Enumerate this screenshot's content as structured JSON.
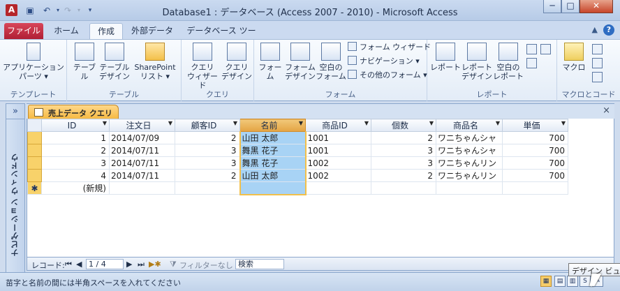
{
  "window": {
    "title": "Database1 : データベース (Access 2007 - 2010) - Microsoft Access",
    "app_icon": "A",
    "qat": [
      "save-icon",
      "undo-icon",
      "redo-icon",
      "customize-icon"
    ],
    "min": "─",
    "max": "□",
    "close": "✕"
  },
  "tabs": [
    {
      "label": "ファイル"
    },
    {
      "label": "ホーム"
    },
    {
      "label": "作成"
    },
    {
      "label": "外部データ"
    },
    {
      "label": "データベース ツール"
    }
  ],
  "ribbon": {
    "groups": {
      "template": {
        "label": "テンプレート",
        "app_parts_1": "アプリケーション",
        "app_parts_2": "パーツ ▾"
      },
      "table": {
        "label": "テーブル",
        "table": "テーブル",
        "table_design_1": "テーブル",
        "table_design_2": "デザイン",
        "sharepoint_1": "SharePoint",
        "sharepoint_2": "リスト ▾"
      },
      "query": {
        "label": "クエリ",
        "wizard_1": "クエリ",
        "wizard_2": "ウィザード",
        "design_1": "クエリ",
        "design_2": "デザイン"
      },
      "form": {
        "label": "フォーム",
        "form": "フォーム",
        "form_design_1": "フォーム",
        "form_design_2": "デザイン",
        "blank_1": "空白の",
        "blank_2": "フォーム",
        "form_wizard": "フォーム ウィザード",
        "navigation": "ナビゲーション ▾",
        "more_forms": "その他のフォーム ▾"
      },
      "report": {
        "label": "レポート",
        "report": "レポート",
        "report_design_1": "レポート",
        "report_design_2": "デザイン",
        "blank_1": "空白の",
        "blank_2": "レポート"
      },
      "macro": {
        "label": "マクロとコード",
        "macro": "マクロ"
      }
    }
  },
  "nav_pane": {
    "toggle": "»",
    "label": "ナビゲーション ウィンドウ"
  },
  "document": {
    "tab_label": "売上データ クエリ",
    "close": "×",
    "columns": [
      "ID",
      "注文日",
      "顧客ID",
      "名前",
      "商品ID",
      "個数",
      "商品名",
      "単価"
    ],
    "rows": [
      [
        "1",
        "2014/07/09",
        "2",
        "山田 太郎",
        "1001",
        "2",
        "ワニちゃんシャ",
        "700"
      ],
      [
        "2",
        "2014/07/11",
        "3",
        "舞黒 花子",
        "1001",
        "3",
        "ワニちゃんシャ",
        "700"
      ],
      [
        "3",
        "2014/07/11",
        "3",
        "舞黒 花子",
        "1002",
        "3",
        "ワニちゃんリン",
        "700"
      ],
      [
        "4",
        "2014/07/11",
        "2",
        "山田 太郎",
        "1002",
        "2",
        "ワニちゃんリン",
        "700"
      ]
    ],
    "new_row_marker": "✱",
    "new_row_label": "(新規)"
  },
  "record_nav": {
    "label": "レコード:",
    "first": "⏮",
    "prev": "◀",
    "current": "1 / 4",
    "next": "▶",
    "last": "⏭",
    "new": "▶✱",
    "filter": "フィルターなし",
    "search": "検索"
  },
  "status": {
    "text": "苗字と名前の間には半角スペースを入れてください",
    "tooltip": "デザイン ビュー"
  }
}
